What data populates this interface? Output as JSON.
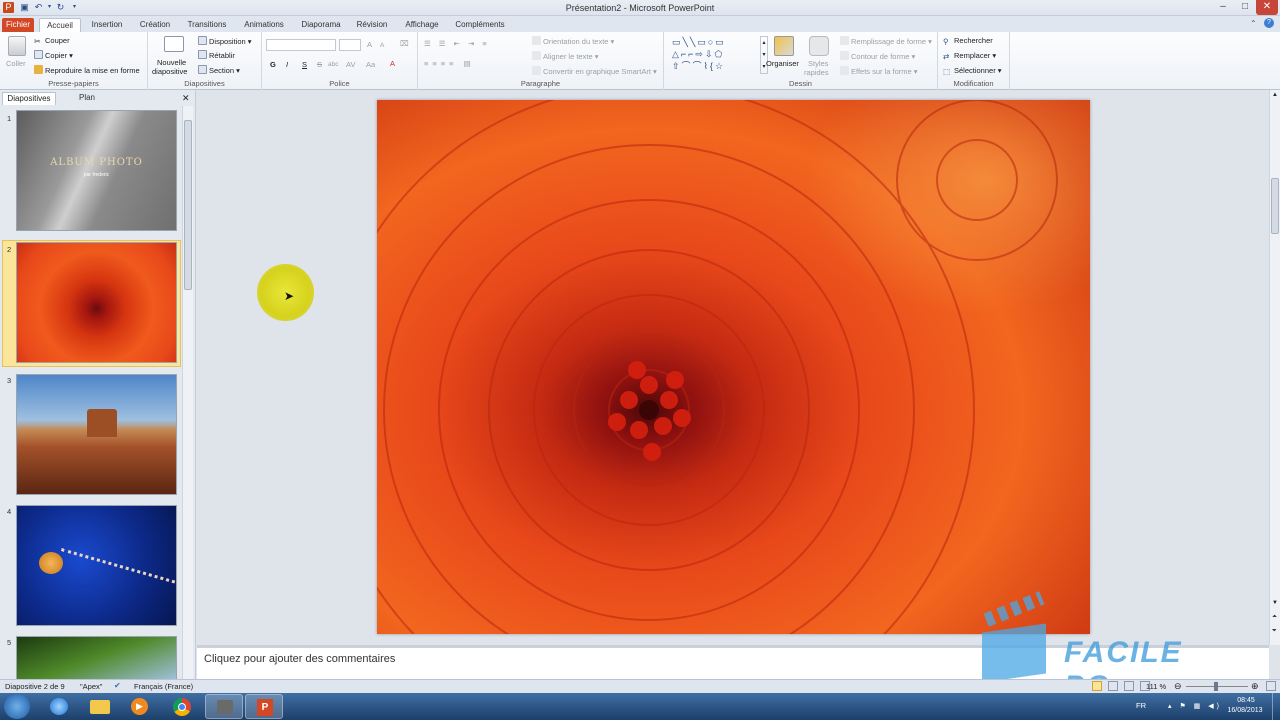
{
  "window": {
    "title": "Présentation2 - Microsoft PowerPoint",
    "controls": [
      "–",
      "□",
      "✕"
    ]
  },
  "tabs": {
    "file": "Fichier",
    "items": [
      "Accueil",
      "Insertion",
      "Création",
      "Transitions",
      "Animations",
      "Diaporama",
      "Révision",
      "Affichage",
      "Compléments"
    ]
  },
  "ribbon": {
    "clipboard": {
      "paste": "Coller",
      "cut": "Couper",
      "copy": "Copier",
      "format_painter": "Reproduire la mise en forme",
      "label": "Presse-papiers"
    },
    "slides": {
      "new_slide_1": "Nouvelle",
      "new_slide_2": "diapositive",
      "layout": "Disposition",
      "reset": "Rétablir",
      "section": "Section",
      "label": "Diapositives"
    },
    "font": {
      "bold": "G",
      "italic": "I",
      "underline": "S",
      "strike": "S",
      "shadow": "abc",
      "spacing": "AV",
      "case": "Aa",
      "grow": "A",
      "shrink": "A",
      "label": "Police"
    },
    "paragraph": {
      "text_direction": "Orientation du texte",
      "align_text": "Aligner le texte",
      "smartart": "Convertir en graphique SmartArt",
      "label": "Paragraphe"
    },
    "drawing": {
      "arrange": "Organiser",
      "quick_styles_1": "Styles",
      "quick_styles_2": "rapides",
      "shape_fill": "Remplissage de forme",
      "shape_outline": "Contour de forme",
      "shape_effects": "Effets sur la forme",
      "label": "Dessin"
    },
    "editing": {
      "find": "Rechercher",
      "replace": "Remplacer",
      "select": "Sélectionner",
      "label": "Modification"
    }
  },
  "left_panel": {
    "tabs": [
      "Diapositives",
      "Plan"
    ],
    "close": "✕",
    "slides": [
      {
        "num": "1",
        "title": "ALBUM PHOTO",
        "subtitle": "par frederic"
      },
      {
        "num": "2"
      },
      {
        "num": "3"
      },
      {
        "num": "4"
      },
      {
        "num": "5"
      }
    ]
  },
  "notes": {
    "placeholder": "Cliquez pour ajouter des commentaires"
  },
  "status": {
    "slide_info": "Diapositive 2 de 9",
    "theme": "\"Apex\"",
    "language": "Français (France)",
    "zoom": "111 %"
  },
  "taskbar": {
    "lang": "FR",
    "time": "08:45",
    "date": "16/08/2013"
  },
  "watermark": {
    "text": "FACILE PC"
  },
  "colors": {
    "accent_file": "#d24726",
    "taskbar": "#2a5283",
    "watermark": "#3a9ad9"
  }
}
